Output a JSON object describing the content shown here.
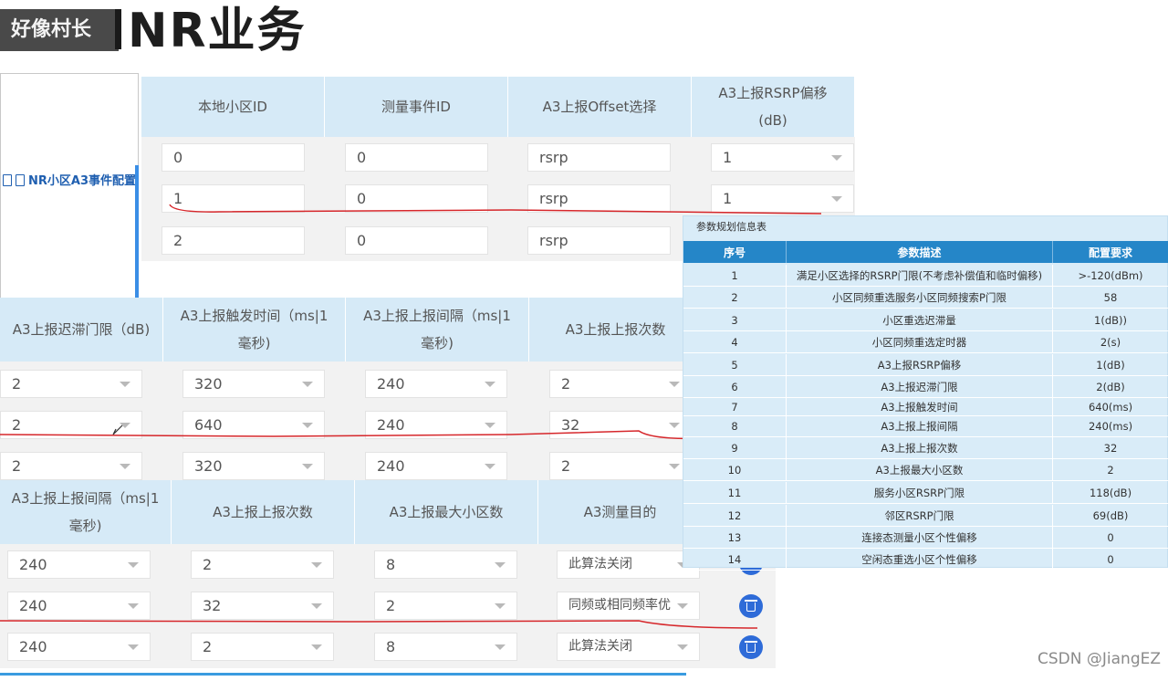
{
  "watermark": "好像村长",
  "title": "NR业务",
  "tree": {
    "item_label": "NR小区A3事件配置"
  },
  "table1": {
    "headers": [
      "本地小区ID",
      "测量事件ID",
      "A3上报Offset选择",
      "A3上报RSRP偏移\n(dB)"
    ],
    "rows": [
      [
        "0",
        "0",
        "rsrp",
        "1"
      ],
      [
        "1",
        "0",
        "rsrp",
        "1"
      ],
      [
        "2",
        "0",
        "rsrp",
        ""
      ]
    ]
  },
  "table2": {
    "headers": [
      "A3上报迟滞门限（dB)",
      "A3上报触发时间（ms|1\n毫秒)",
      "A3上报上报间隔（ms|1\n毫秒)",
      "A3上报上报次数"
    ],
    "rows": [
      [
        "2",
        "320",
        "240",
        "2"
      ],
      [
        "2",
        "640",
        "240",
        "32"
      ],
      [
        "2",
        "320",
        "240",
        "2"
      ]
    ]
  },
  "table3": {
    "headers": [
      "A3上报上报间隔（ms|1\n毫秒)",
      "A3上报上报次数",
      "A3上报最大小区数",
      "A3测量目的"
    ],
    "rows": [
      [
        "240",
        "2",
        "8",
        "此算法关闭"
      ],
      [
        "240",
        "32",
        "2",
        "同频或相同频率优"
      ],
      [
        "240",
        "2",
        "8",
        "此算法关闭"
      ]
    ]
  },
  "info_table": {
    "title": "参数规划信息表",
    "headers": [
      "序号",
      "参数描述",
      "配置要求"
    ],
    "rows": [
      [
        "1",
        "满足小区选择的RSRP门限(不考虑补偿值和临时偏移)",
        ">-120(dBm)"
      ],
      [
        "2",
        "小区同频重选服务小区同频搜索P门限",
        "58"
      ],
      [
        "3",
        "小区重选迟滞量",
        "1(dB))"
      ],
      [
        "4",
        "小区同频重选定时器",
        "2(s)"
      ],
      [
        "5",
        "A3上报RSRP偏移",
        "1(dB)"
      ],
      [
        "6",
        "A3上报迟滞门限",
        "2(dB)"
      ],
      [
        "7",
        "A3上报触发时间",
        "640(ms)"
      ],
      [
        "8",
        "A3上报上报间隔",
        "240(ms)"
      ],
      [
        "9",
        "A3上报上报次数",
        "32"
      ],
      [
        "10",
        "A3上报最大小区数",
        "2"
      ],
      [
        "11",
        "服务小区RSRP门限",
        "118(dB)"
      ],
      [
        "12",
        "邻区RSRP门限",
        "69(dB)"
      ],
      [
        "13",
        "连接态测量小区个性偏移",
        "0"
      ],
      [
        "14",
        "空闲态重选小区个性偏移",
        "0"
      ]
    ]
  },
  "footer": "CSDN @JiangEZ"
}
